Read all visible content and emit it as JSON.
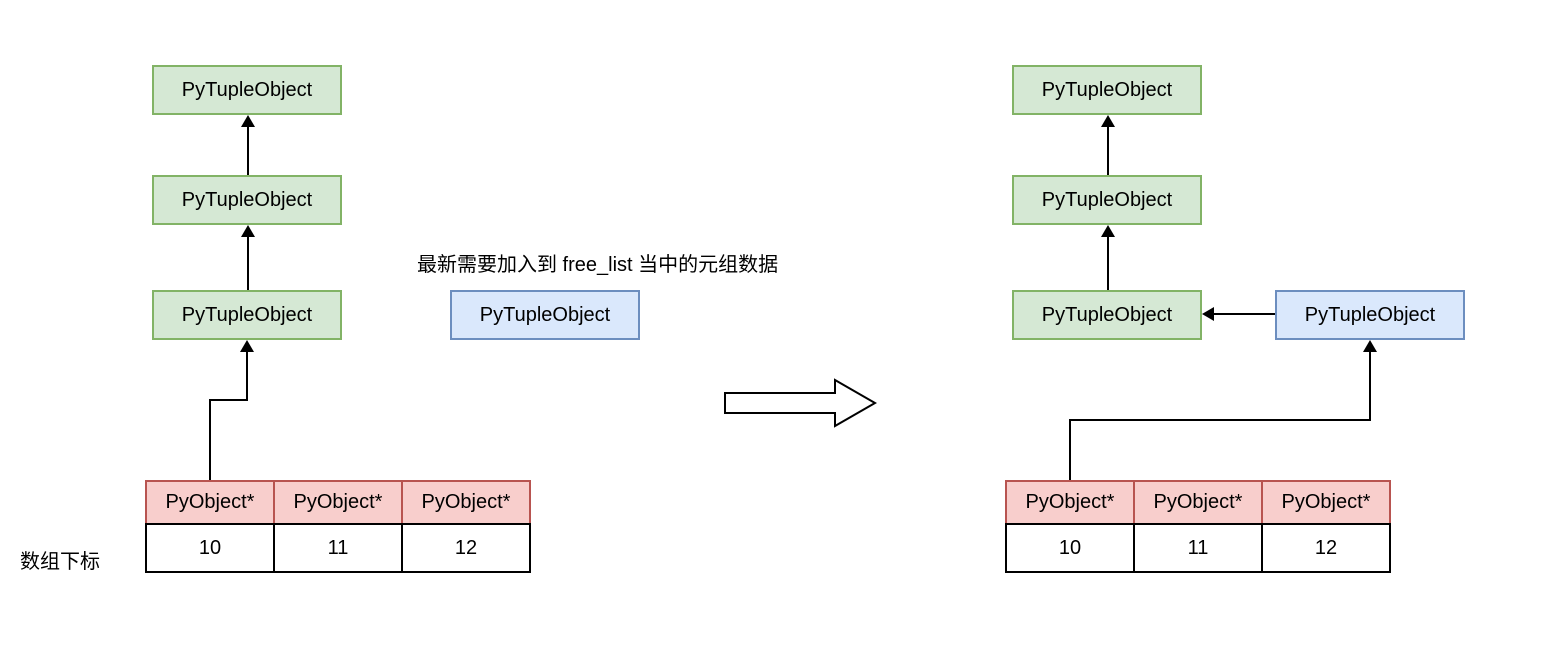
{
  "left": {
    "tuple1": "PyTupleObject",
    "tuple2": "PyTupleObject",
    "tuple3": "PyTupleObject",
    "table": {
      "headers": [
        "PyObject*",
        "PyObject*",
        "PyObject*"
      ],
      "indices": [
        "10",
        "11",
        "12"
      ]
    },
    "index_label": "数组下标"
  },
  "middle": {
    "caption": "最新需要加入到 free_list 当中的元组数据",
    "new_tuple": "PyTupleObject"
  },
  "right": {
    "tuple1": "PyTupleObject",
    "tuple2": "PyTupleObject",
    "tuple3": "PyTupleObject",
    "new_tuple": "PyTupleObject",
    "table": {
      "headers": [
        "PyObject*",
        "PyObject*",
        "PyObject*"
      ],
      "indices": [
        "10",
        "11",
        "12"
      ]
    }
  }
}
